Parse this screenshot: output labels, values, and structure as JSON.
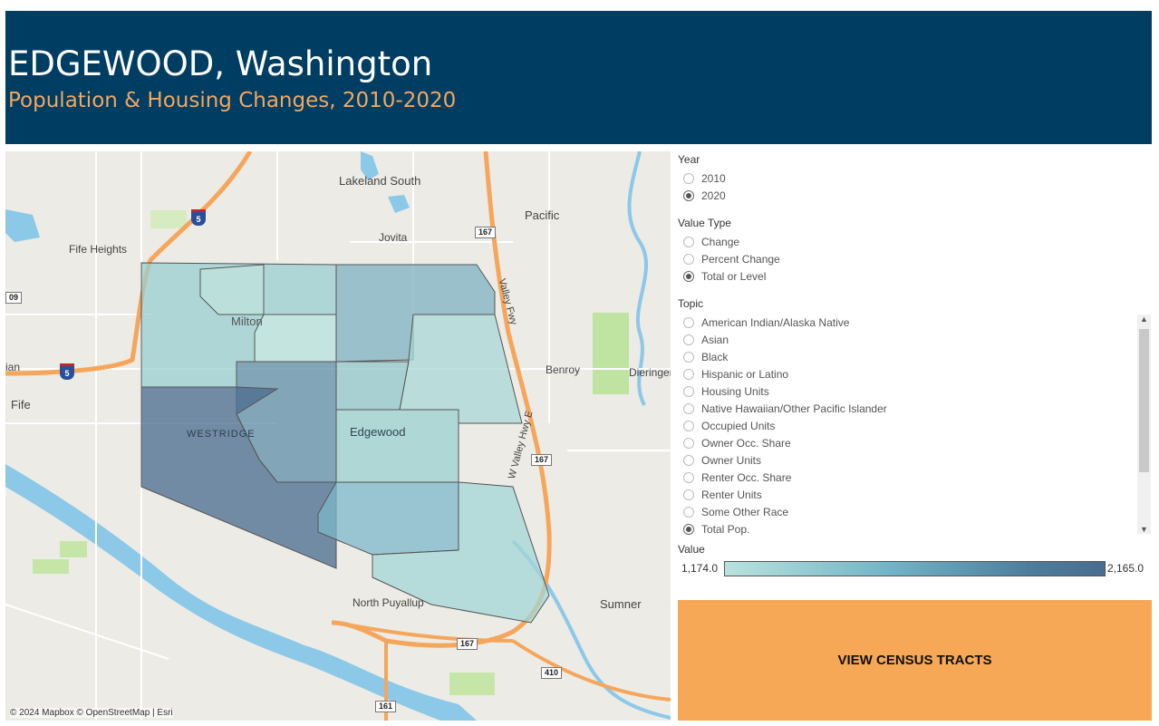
{
  "header": {
    "title": "EDGEWOOD, Washington",
    "subtitle": "Population & Housing Changes, 2010-2020"
  },
  "map": {
    "places": {
      "lakeland_south": "Lakeland South",
      "pacific": "Pacific",
      "jovita": "Jovita",
      "fife_heights": "Fife Heights",
      "milton": "Milton",
      "fife": "Fife",
      "benroy": "Benroy",
      "dieringer": "Dieringer",
      "westridge": "WESTRIDGE",
      "edgewood": "Edgewood",
      "north_puyallup": "North Puyallup",
      "sumner": "Sumner",
      "ian": "ian",
      "valley_fwy": "Valley Fwy",
      "w_valley_hwy": "W Valley Hwy E"
    },
    "shields": {
      "i5_north": "5",
      "i5_west": "5",
      "sr167_top": "167",
      "sr167_mid": "167",
      "sr167_bottom": "167",
      "sr410": "410",
      "sr161": "161",
      "sr509": "09"
    },
    "attribution": "© 2024 Mapbox © OpenStreetMap | Esri"
  },
  "filters": {
    "year": {
      "title": "Year",
      "options": [
        "2010",
        "2020"
      ],
      "selected": "2020"
    },
    "value_type": {
      "title": "Value Type",
      "options": [
        "Change",
        "Percent Change",
        "Total or Level"
      ],
      "selected": "Total or Level"
    },
    "topic": {
      "title": "Topic",
      "options": [
        "American Indian/Alaska Native",
        "Asian",
        "Black",
        "Hispanic or Latino",
        "Housing Units",
        "Native Hawaiian/Other Pacific Islander",
        "Occupied Units",
        "Owner Occ. Share",
        "Owner Units",
        "Renter Occ. Share",
        "Renter Units",
        "Some Other Race",
        "Total Pop."
      ],
      "selected": "Total Pop."
    }
  },
  "legend": {
    "title": "Value",
    "min": "1,174.0",
    "max": "2,165.0",
    "color_low": "#b9e2de",
    "color_high": "#4a6c8f"
  },
  "button": {
    "label": "VIEW CENSUS TRACTS",
    "color": "#f7a856"
  },
  "colors": {
    "header_bg": "#003d63",
    "title": "#ffffff",
    "subtitle": "#f5a65b"
  }
}
